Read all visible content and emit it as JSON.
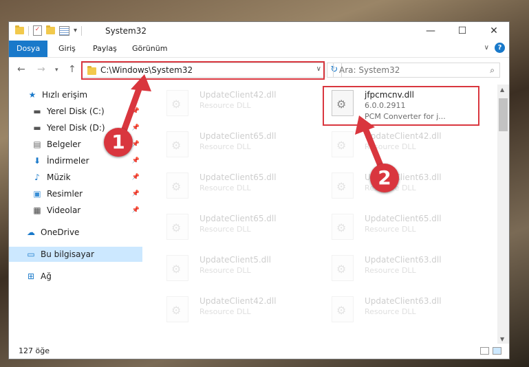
{
  "window": {
    "title": "System32"
  },
  "ribbon": {
    "tabs": [
      "Dosya",
      "Giriş",
      "Paylaş",
      "Görünüm"
    ]
  },
  "address": {
    "path": "C:\\Windows\\System32"
  },
  "search": {
    "placeholder": "Ara: System32"
  },
  "sidebar": {
    "items": [
      {
        "label": "Hızlı erişim",
        "icon": "star-icon",
        "pinned": false
      },
      {
        "label": "Yerel Disk (C:)",
        "icon": "disk-icon",
        "pinned": true
      },
      {
        "label": "Yerel Disk (D:)",
        "icon": "disk-icon",
        "pinned": true
      },
      {
        "label": "Belgeler",
        "icon": "documents-icon",
        "pinned": true
      },
      {
        "label": "İndirmeler",
        "icon": "download-icon",
        "pinned": true
      },
      {
        "label": "Müzik",
        "icon": "music-icon",
        "pinned": true
      },
      {
        "label": "Resimler",
        "icon": "pictures-icon",
        "pinned": true
      },
      {
        "label": "Videolar",
        "icon": "videos-icon",
        "pinned": true
      },
      {
        "label": "OneDrive",
        "icon": "cloud-icon",
        "pinned": false
      },
      {
        "label": "Bu bilgisayar",
        "icon": "computer-icon",
        "pinned": false
      },
      {
        "label": "Ağ",
        "icon": "network-icon",
        "pinned": false
      }
    ]
  },
  "files": {
    "highlighted": {
      "name": "jfpcmcnv.dll",
      "version": "6.0.0.2911",
      "desc": "PCM Converter for j..."
    },
    "left_column": [
      {
        "name": "UpdateClient42.dll",
        "desc": "Resource DLL"
      },
      {
        "name": "UpdateClient65.dll",
        "desc": "Resource DLL"
      },
      {
        "name": "UpdateClient65.dll",
        "desc": "Resource DLL"
      },
      {
        "name": "UpdateClient65.dll",
        "desc": "Resource DLL"
      },
      {
        "name": "UpdateClient5.dll",
        "desc": "Resource DLL"
      },
      {
        "name": "UpdateClient42.dll",
        "desc": "Resource DLL"
      }
    ],
    "right_column": [
      {
        "name": "UpdateClient42.dll",
        "desc": "Resource DLL"
      },
      {
        "name": "UpdateClient63.dll",
        "desc": "Resource DLL"
      },
      {
        "name": "UpdateClient65.dll",
        "desc": "Resource DLL"
      },
      {
        "name": "UpdateClient63.dll",
        "desc": "Resource DLL"
      },
      {
        "name": "UpdateClient63.dll",
        "desc": "Resource DLL"
      }
    ]
  },
  "status": {
    "item_count": "127 öğe"
  },
  "annotations": {
    "step1": "1",
    "step2": "2",
    "color": "#d9363e"
  }
}
